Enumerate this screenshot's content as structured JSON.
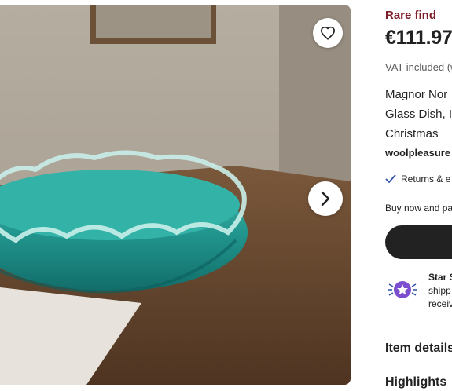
{
  "listing": {
    "badge": "Rare find",
    "price": "€111.97",
    "vat": "VAT included (w",
    "title_lines": [
      "Magnor Nor",
      "Glass Dish, I",
      "Christmas"
    ],
    "shop": "woolpleasure",
    "returns": "Returns & e",
    "buy_now_text": "Buy now and pa",
    "star_seller": {
      "line1": "Star S",
      "line2": "shipp",
      "line3": "receiv"
    },
    "sections": {
      "item_details": "Item details",
      "highlights": "Highlights"
    }
  },
  "icons": {
    "favorite": "heart-icon",
    "next": "chevron-right-icon",
    "returns": "check-icon",
    "star_seller": "star-seller-badge-icon"
  },
  "colors": {
    "rare_find": "#7d1f2a",
    "button": "#222222",
    "badge_purple": "#7b4fcf"
  }
}
